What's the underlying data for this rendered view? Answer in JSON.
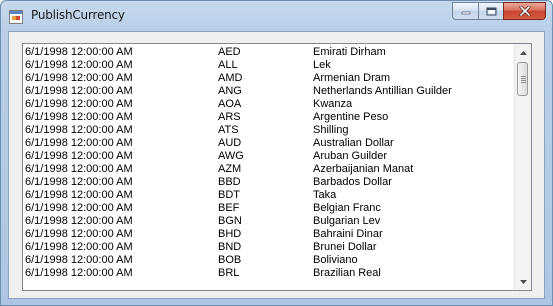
{
  "window": {
    "title": "PublishCurrency",
    "icon": "app-window-icon",
    "controls": [
      "minimize-icon",
      "maximize-icon",
      "close-icon"
    ]
  },
  "listbox": {
    "rows": [
      {
        "date": "6/1/1998 12:00:00 AM",
        "code": "AED",
        "name": "Emirati Dirham"
      },
      {
        "date": "6/1/1998 12:00:00 AM",
        "code": "ALL",
        "name": "Lek"
      },
      {
        "date": "6/1/1998 12:00:00 AM",
        "code": "AMD",
        "name": "Armenian Dram"
      },
      {
        "date": "6/1/1998 12:00:00 AM",
        "code": "ANG",
        "name": "Netherlands Antillian Guilder"
      },
      {
        "date": "6/1/1998 12:00:00 AM",
        "code": "AOA",
        "name": "Kwanza"
      },
      {
        "date": "6/1/1998 12:00:00 AM",
        "code": "ARS",
        "name": "Argentine Peso"
      },
      {
        "date": "6/1/1998 12:00:00 AM",
        "code": "ATS",
        "name": "Shilling"
      },
      {
        "date": "6/1/1998 12:00:00 AM",
        "code": "AUD",
        "name": "Australian Dollar"
      },
      {
        "date": "6/1/1998 12:00:00 AM",
        "code": "AWG",
        "name": "Aruban Guilder"
      },
      {
        "date": "6/1/1998 12:00:00 AM",
        "code": "AZM",
        "name": "Azerbaijanian Manat"
      },
      {
        "date": "6/1/1998 12:00:00 AM",
        "code": "BBD",
        "name": "Barbados Dollar"
      },
      {
        "date": "6/1/1998 12:00:00 AM",
        "code": "BDT",
        "name": "Taka"
      },
      {
        "date": "6/1/1998 12:00:00 AM",
        "code": "BEF",
        "name": "Belgian Franc"
      },
      {
        "date": "6/1/1998 12:00:00 AM",
        "code": "BGN",
        "name": "Bulgarian Lev"
      },
      {
        "date": "6/1/1998 12:00:00 AM",
        "code": "BHD",
        "name": "Bahraini Dinar"
      },
      {
        "date": "6/1/1998 12:00:00 AM",
        "code": "BND",
        "name": "Brunei Dollar"
      },
      {
        "date": "6/1/1998 12:00:00 AM",
        "code": "BOB",
        "name": "Boliviano"
      },
      {
        "date": "6/1/1998 12:00:00 AM",
        "code": "BRL",
        "name": "Brazilian Real"
      }
    ]
  },
  "scrollbar": {
    "up_icon": "scroll-up-arrow-icon",
    "down_icon": "scroll-down-arrow-icon"
  },
  "colors": {
    "title_bar": "#b9cfe8",
    "close_button": "#c7452f",
    "client_background": "#f0f0f0",
    "list_background": "#ffffff"
  }
}
